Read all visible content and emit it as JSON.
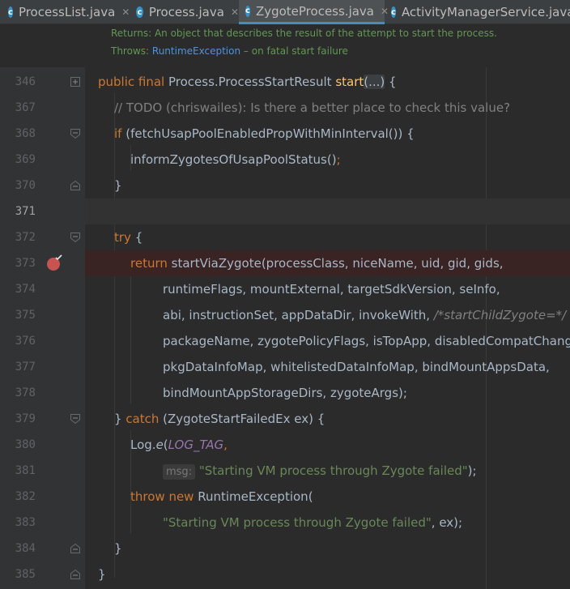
{
  "tabs": [
    {
      "name": "ProcessList.java",
      "active": false
    },
    {
      "name": "Process.java",
      "active": false
    },
    {
      "name": "ZygoteProcess.java",
      "active": true
    },
    {
      "name": "ActivityManagerService.java",
      "active": false
    }
  ],
  "doc": {
    "returns_label": "Returns:",
    "returns_text": "An object that describes the result of the attempt to start the process.",
    "throws_label": "Throws:",
    "throws_link": "RuntimeException",
    "throws_text": "– on fatal start failure"
  },
  "line_numbers": [
    "346",
    "367",
    "368",
    "369",
    "370",
    "371",
    "372",
    "373",
    "374",
    "375",
    "376",
    "377",
    "378",
    "379",
    "380",
    "381",
    "382",
    "383",
    "384",
    "385"
  ],
  "code": {
    "l346": {
      "kw": "public final ",
      "type": "Process.ProcessStartResult ",
      "fn": "start",
      "fold": "(...)",
      "rest": " {"
    },
    "l367": {
      "comment": "// TODO (chriswailes): Is there a better place to check this value?"
    },
    "l368": {
      "kw": "if ",
      "rest": "(fetchUsapPoolEnabledPropWithMinInterval()) {"
    },
    "l369": {
      "call": "informZygotesOfUsapPoolStatus()",
      "semi": ";"
    },
    "l370": {
      "rest": "}"
    },
    "l371": {
      "rest": ""
    },
    "l372": {
      "kw": "try ",
      "rest": "{"
    },
    "l373": {
      "kw": "return ",
      "rest": "startViaZygote(processClass, niceName, uid, gid, gids,"
    },
    "l374": {
      "rest": "runtimeFlags, mountExternal, targetSdkVersion, seInfo,"
    },
    "l375": {
      "rest": "abi, instructionSet, appDataDir, invokeWith, ",
      "comment": "/*startChildZygote=*/"
    },
    "l376": {
      "rest": "packageName, zygotePolicyFlags, isTopApp, disabledCompatChanges,"
    },
    "l377": {
      "rest": "pkgDataInfoMap, whitelistedDataInfoMap, bindMountAppsData,"
    },
    "l378": {
      "rest": "bindMountAppStorageDirs, zygoteArgs);"
    },
    "l379": {
      "pre": "} ",
      "kw": "catch ",
      "rest": "(ZygoteStartFailedEx ex) {"
    },
    "l380": {
      "pre": "Log.",
      "ital_fn": "e",
      "open": "(",
      "const": "LOG_TAG",
      "rest": ","
    },
    "l381": {
      "hint": "msg:",
      "str": "\"Starting VM process through Zygote failed\"",
      "rest": ");"
    },
    "l382": {
      "kw": "throw new ",
      "rest": "RuntimeException("
    },
    "l383": {
      "str": "\"Starting VM process through Zygote failed\"",
      "rest": ", ex);"
    },
    "l384": {
      "rest": "}"
    },
    "l385": {
      "rest": "}"
    }
  },
  "colors": {
    "keyword": "#cc7832",
    "string": "#6a8759",
    "comment": "#808080",
    "function": "#ffc66d",
    "constant": "#9876aa",
    "breakpoint": "#c75450"
  },
  "icons": {
    "tab": "java-class-icon",
    "breakpoint": "breakpoint-icon",
    "fold": "fold-marker-icon"
  }
}
